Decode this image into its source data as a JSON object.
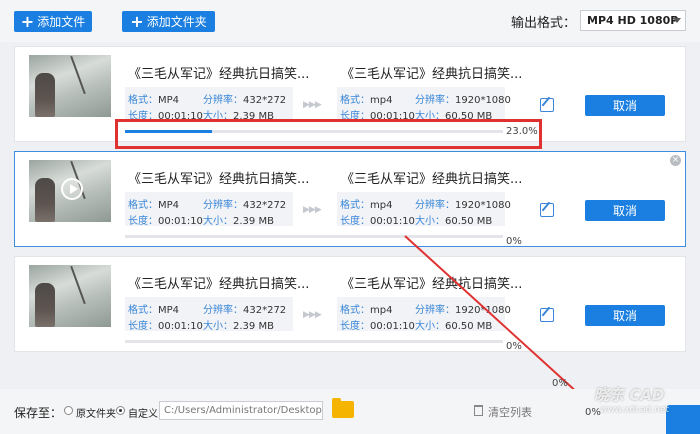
{
  "toolbar": {
    "add_file_label": "添加文件",
    "add_folder_label": "添加文件夹",
    "output_format_label": "输出格式：",
    "output_format_value": "MP4  HD 1080P"
  },
  "labels": {
    "format": "格式：",
    "resolution": "分辨率：",
    "duration": "长度：",
    "size": "大小："
  },
  "tasks": [
    {
      "src_title": "《三毛从军记》经典抗日搞笑...",
      "src_format": "MP4",
      "src_resolution": "432*272",
      "src_duration": "00:01:10",
      "src_size": "2.39 MB",
      "dst_title": "《三毛从军记》经典抗日搞笑...",
      "dst_format": "mp4",
      "dst_resolution": "1920*1080",
      "dst_duration": "00:01:10",
      "dst_size": "60.50 MB",
      "cancel_label": "取消",
      "progress": 0.23,
      "progress_label": "23.0%"
    },
    {
      "src_title": "《三毛从军记》经典抗日搞笑...",
      "src_format": "MP4",
      "src_resolution": "432*272",
      "src_duration": "00:01:10",
      "src_size": "2.39 MB",
      "dst_title": "《三毛从军记》经典抗日搞笑...",
      "dst_format": "mp4",
      "dst_resolution": "1920*1080",
      "dst_duration": "00:01:10",
      "dst_size": "60.50 MB",
      "cancel_label": "取消",
      "progress": 0,
      "progress_label": "0%"
    },
    {
      "src_title": "《三毛从军记》经典抗日搞笑...",
      "src_format": "MP4",
      "src_resolution": "432*272",
      "src_duration": "00:01:10",
      "src_size": "2.39 MB",
      "dst_title": "《三毛从军记》经典抗日搞笑...",
      "dst_format": "mp4",
      "dst_resolution": "1920*1080",
      "dst_duration": "00:01:10",
      "dst_size": "60.50 MB",
      "cancel_label": "取消",
      "progress": 0,
      "progress_label": "0%"
    }
  ],
  "footer": {
    "save_to_label": "保存至：",
    "option_original": "原文件夹",
    "option_custom": "自定义",
    "path_value": "C:/Users/Administrator/Desktop",
    "clear_list_label": "清空列表",
    "total_progress_top": "0%",
    "total_progress_bottom": "0%",
    "watermark": "晓东 CAD",
    "watermark_url": "www.xdcad.net"
  },
  "colors": {
    "accent": "#1a7fe0",
    "highlight": "#e03131"
  }
}
